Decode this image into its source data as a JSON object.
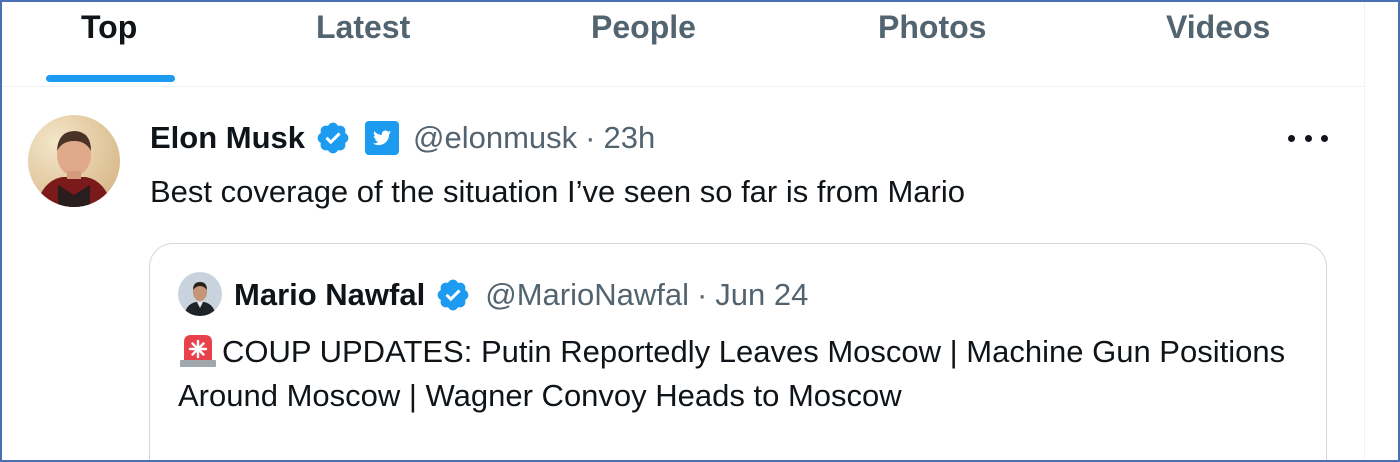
{
  "tabs": [
    {
      "label": "Top",
      "active": true
    },
    {
      "label": "Latest",
      "active": false
    },
    {
      "label": "People",
      "active": false
    },
    {
      "label": "Photos",
      "active": false
    },
    {
      "label": "Videos",
      "active": false
    }
  ],
  "tweet": {
    "author_name": "Elon Musk",
    "handle": "@elonmusk",
    "separator": "·",
    "time": "23h",
    "text": "Best coverage of the situation I’ve seen so far is from Mario",
    "icons": [
      "verified-badge-icon",
      "twitter-bird-badge-icon",
      "more-options-icon"
    ]
  },
  "quote": {
    "author_name": "Mario Nawfal",
    "handle": "@MarioNawfal",
    "separator": "·",
    "time": "Jun 24",
    "text": "COUP UPDATES: Putin Reportedly Leaves Moscow | Machine Gun Positions Around Moscow | Wagner Convoy Heads to Moscow",
    "icons": [
      "verified-badge-icon",
      "siren-emoji-icon"
    ]
  },
  "colors": {
    "accent": "#1d9bf0",
    "text_primary": "#0f1419",
    "text_secondary": "#536471",
    "frame_border": "#4a6fb5"
  }
}
